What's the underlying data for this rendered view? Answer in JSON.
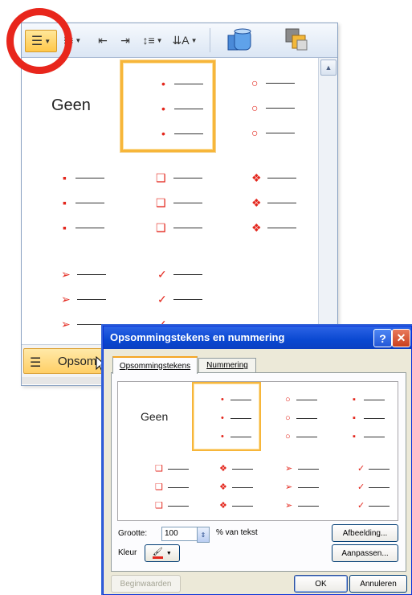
{
  "gallery": {
    "none_label": "Geen",
    "bottom_item_label": "Opsom"
  },
  "dialog": {
    "title": "Opsommingstekens en nummering",
    "tabs": [
      "Opsommingstekens",
      "Nummering"
    ],
    "none_label": "Geen",
    "size_label": "Grootte:",
    "size_value": "100",
    "size_unit": "% van tekst",
    "color_label": "Kleur",
    "picture_button": "Afbeelding...",
    "customize_button": "Aanpassen...",
    "reset_button": "Beginwaarden",
    "ok_button": "OK",
    "cancel_button": "Annuleren"
  },
  "colors": {
    "bullet": "#e3261c",
    "selection": "#f7b63a",
    "highlight_ring": "#e8261c"
  },
  "icons": [
    "bullets-icon",
    "numbering-icon",
    "decrease-indent-icon",
    "increase-indent-icon",
    "line-spacing-icon",
    "text-direction-icon",
    "shape-icon",
    "arrange-icon",
    "help-icon",
    "close-icon",
    "font-color-icon"
  ]
}
